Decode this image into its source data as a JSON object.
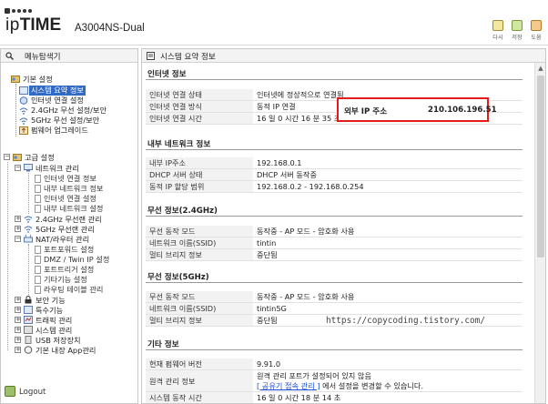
{
  "header": {
    "brand_lo": "ip",
    "brand_hi": "TIME",
    "model": "A3004NS-Dual",
    "buttons": [
      {
        "label": "다시",
        "icon": "refresh-icon"
      },
      {
        "label": "저장",
        "icon": "save-icon"
      },
      {
        "label": "도움",
        "icon": "help-icon"
      }
    ]
  },
  "menu": {
    "title": "메뉴탐색기",
    "basic": {
      "label": "기본 설정",
      "items": [
        {
          "label": "시스템 요약 정보",
          "selected": true
        },
        {
          "label": "인터넷 연결 설정"
        },
        {
          "label": "2.4GHz 무선 설정/보안"
        },
        {
          "label": "5GHz 무선 설정/보안"
        },
        {
          "label": "펌웨어 업그레이드"
        }
      ]
    },
    "advanced": {
      "label": "고급 설정",
      "network": {
        "label": "네트워크 관리",
        "items": [
          "인터넷 연결 정보",
          "내부 네트워크 정보",
          "인터넷 연결 설정",
          "내부 네트워크 설정"
        ]
      },
      "wifi24": "2.4GHz 무선랜 관리",
      "wifi5": "5GHz 무선랜 관리",
      "nat": {
        "label": "NAT/라우터 관리",
        "items": [
          "포트포워드 설정",
          "DMZ / Twin IP 설정",
          "포트트리거 설정",
          "기타기능 설정",
          "라우팅 테이블 관리"
        ]
      },
      "security": "보안 기능",
      "special": "특수기능",
      "traffic": "트래픽 관리",
      "system": "시스템 관리",
      "usb": "USB 저장장치",
      "app": "기본 내장 App관리"
    },
    "logout": "Logout"
  },
  "content": {
    "title": "시스템 요약 정보",
    "sections": [
      {
        "title": "인터넷 정보",
        "rows": [
          {
            "key": "인터넷 연결 상태",
            "value": "인터넷에 정상적으로 연결됨"
          },
          {
            "key": "인터넷 연결 방식",
            "value": "동적 IP 연결"
          },
          {
            "key": "인터넷 연결 시간",
            "value": "16 일 0 시간 16 분 35 초"
          }
        ]
      },
      {
        "title": "내부 네트워크 정보",
        "rows": [
          {
            "key": "내부 IP주소",
            "value": "192.168.0.1"
          },
          {
            "key": "DHCP 서버 상태",
            "value": "DHCP 서버 동작중"
          },
          {
            "key": "동적 IP 할당 범위",
            "value": "192.168.0.2 - 192.168.0.254"
          }
        ]
      },
      {
        "title": "무선 정보(2.4GHz)",
        "rows": [
          {
            "key": "무선 동작 모드",
            "value": "동작중 - AP 모드 - 암호화 사용"
          },
          {
            "key": "네트워크 이름(SSID)",
            "value": "tintin"
          },
          {
            "key": "멀티 브리지 정보",
            "value": "중단됨"
          }
        ]
      },
      {
        "title": "무선 정보(5GHz)",
        "rows": [
          {
            "key": "무선 동작 모드",
            "value": "동작중 - AP 모드 - 암호화 사용"
          },
          {
            "key": "네트워크 이름(SSID)",
            "value": "tintin5G"
          },
          {
            "key": "멀티 브리지 정보",
            "value": "중단됨"
          }
        ]
      },
      {
        "title": "기타 정보",
        "rows": [
          {
            "key": "현재 펌웨어 버전",
            "value": "9.91.0"
          },
          {
            "key": "원격 관리 정보",
            "value": "원격 관리 포트가 설정되어 있지 않음",
            "link": "[ 공유기 접속 관리 ]",
            "after": " 에서 설정을 변경할 수 있습니다."
          },
          {
            "key": "시스템 동작 시간",
            "value": "16 일 0 시간 18 분 14 초"
          }
        ]
      }
    ],
    "callout": {
      "key": "외부 IP 주소",
      "value": "210.106.196.51"
    },
    "watermark": "https://copycoding.tistory.com/"
  }
}
